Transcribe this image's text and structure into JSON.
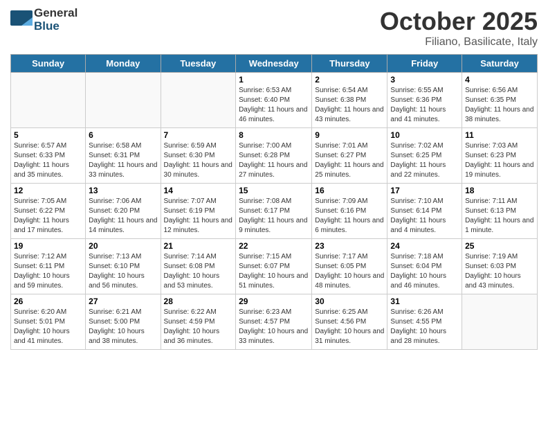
{
  "header": {
    "logo_general": "General",
    "logo_blue": "Blue",
    "month_title": "October 2025",
    "location": "Filiano, Basilicate, Italy"
  },
  "weekdays": [
    "Sunday",
    "Monday",
    "Tuesday",
    "Wednesday",
    "Thursday",
    "Friday",
    "Saturday"
  ],
  "weeks": [
    [
      {
        "day": "",
        "empty": true
      },
      {
        "day": "",
        "empty": true
      },
      {
        "day": "",
        "empty": true
      },
      {
        "day": "1",
        "sunrise": "6:53 AM",
        "sunset": "6:40 PM",
        "daylight": "11 hours and 46 minutes."
      },
      {
        "day": "2",
        "sunrise": "6:54 AM",
        "sunset": "6:38 PM",
        "daylight": "11 hours and 43 minutes."
      },
      {
        "day": "3",
        "sunrise": "6:55 AM",
        "sunset": "6:36 PM",
        "daylight": "11 hours and 41 minutes."
      },
      {
        "day": "4",
        "sunrise": "6:56 AM",
        "sunset": "6:35 PM",
        "daylight": "11 hours and 38 minutes."
      }
    ],
    [
      {
        "day": "5",
        "sunrise": "6:57 AM",
        "sunset": "6:33 PM",
        "daylight": "11 hours and 35 minutes."
      },
      {
        "day": "6",
        "sunrise": "6:58 AM",
        "sunset": "6:31 PM",
        "daylight": "11 hours and 33 minutes."
      },
      {
        "day": "7",
        "sunrise": "6:59 AM",
        "sunset": "6:30 PM",
        "daylight": "11 hours and 30 minutes."
      },
      {
        "day": "8",
        "sunrise": "7:00 AM",
        "sunset": "6:28 PM",
        "daylight": "11 hours and 27 minutes."
      },
      {
        "day": "9",
        "sunrise": "7:01 AM",
        "sunset": "6:27 PM",
        "daylight": "11 hours and 25 minutes."
      },
      {
        "day": "10",
        "sunrise": "7:02 AM",
        "sunset": "6:25 PM",
        "daylight": "11 hours and 22 minutes."
      },
      {
        "day": "11",
        "sunrise": "7:03 AM",
        "sunset": "6:23 PM",
        "daylight": "11 hours and 19 minutes."
      }
    ],
    [
      {
        "day": "12",
        "sunrise": "7:05 AM",
        "sunset": "6:22 PM",
        "daylight": "11 hours and 17 minutes."
      },
      {
        "day": "13",
        "sunrise": "7:06 AM",
        "sunset": "6:20 PM",
        "daylight": "11 hours and 14 minutes."
      },
      {
        "day": "14",
        "sunrise": "7:07 AM",
        "sunset": "6:19 PM",
        "daylight": "11 hours and 12 minutes."
      },
      {
        "day": "15",
        "sunrise": "7:08 AM",
        "sunset": "6:17 PM",
        "daylight": "11 hours and 9 minutes."
      },
      {
        "day": "16",
        "sunrise": "7:09 AM",
        "sunset": "6:16 PM",
        "daylight": "11 hours and 6 minutes."
      },
      {
        "day": "17",
        "sunrise": "7:10 AM",
        "sunset": "6:14 PM",
        "daylight": "11 hours and 4 minutes."
      },
      {
        "day": "18",
        "sunrise": "7:11 AM",
        "sunset": "6:13 PM",
        "daylight": "11 hours and 1 minute."
      }
    ],
    [
      {
        "day": "19",
        "sunrise": "7:12 AM",
        "sunset": "6:11 PM",
        "daylight": "10 hours and 59 minutes."
      },
      {
        "day": "20",
        "sunrise": "7:13 AM",
        "sunset": "6:10 PM",
        "daylight": "10 hours and 56 minutes."
      },
      {
        "day": "21",
        "sunrise": "7:14 AM",
        "sunset": "6:08 PM",
        "daylight": "10 hours and 53 minutes."
      },
      {
        "day": "22",
        "sunrise": "7:15 AM",
        "sunset": "6:07 PM",
        "daylight": "10 hours and 51 minutes."
      },
      {
        "day": "23",
        "sunrise": "7:17 AM",
        "sunset": "6:05 PM",
        "daylight": "10 hours and 48 minutes."
      },
      {
        "day": "24",
        "sunrise": "7:18 AM",
        "sunset": "6:04 PM",
        "daylight": "10 hours and 46 minutes."
      },
      {
        "day": "25",
        "sunrise": "7:19 AM",
        "sunset": "6:03 PM",
        "daylight": "10 hours and 43 minutes."
      }
    ],
    [
      {
        "day": "26",
        "sunrise": "6:20 AM",
        "sunset": "5:01 PM",
        "daylight": "10 hours and 41 minutes."
      },
      {
        "day": "27",
        "sunrise": "6:21 AM",
        "sunset": "5:00 PM",
        "daylight": "10 hours and 38 minutes."
      },
      {
        "day": "28",
        "sunrise": "6:22 AM",
        "sunset": "4:59 PM",
        "daylight": "10 hours and 36 minutes."
      },
      {
        "day": "29",
        "sunrise": "6:23 AM",
        "sunset": "4:57 PM",
        "daylight": "10 hours and 33 minutes."
      },
      {
        "day": "30",
        "sunrise": "6:25 AM",
        "sunset": "4:56 PM",
        "daylight": "10 hours and 31 minutes."
      },
      {
        "day": "31",
        "sunrise": "6:26 AM",
        "sunset": "4:55 PM",
        "daylight": "10 hours and 28 minutes."
      },
      {
        "day": "",
        "empty": true
      }
    ]
  ],
  "labels": {
    "sunrise_prefix": "Sunrise: ",
    "sunset_prefix": "Sunset: ",
    "daylight_label": "Daylight: "
  }
}
